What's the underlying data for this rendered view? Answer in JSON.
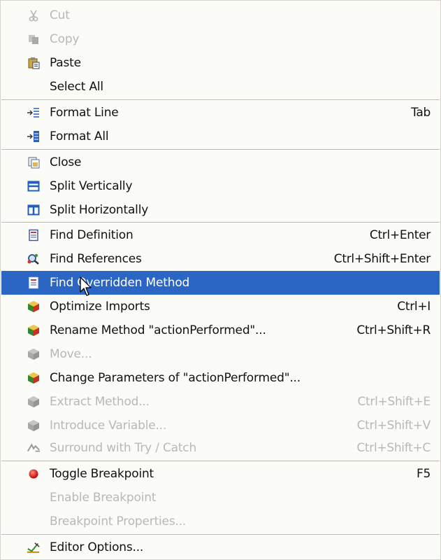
{
  "menu": {
    "items": [
      {
        "label": "Cut",
        "shortcut": "",
        "icon": "cut-icon",
        "enabled": false
      },
      {
        "label": "Copy",
        "shortcut": "",
        "icon": "copy-icon",
        "enabled": false
      },
      {
        "label": "Paste",
        "shortcut": "",
        "icon": "paste-icon",
        "enabled": true
      },
      {
        "label": "Select All",
        "shortcut": "",
        "icon": "",
        "enabled": true
      },
      {
        "label": "Format Line",
        "shortcut": "Tab",
        "icon": "format-line-icon",
        "enabled": true
      },
      {
        "label": "Format All",
        "shortcut": "",
        "icon": "format-all-icon",
        "enabled": true
      },
      {
        "label": "Close",
        "shortcut": "",
        "icon": "close-file-icon",
        "enabled": true
      },
      {
        "label": "Split Vertically",
        "shortcut": "",
        "icon": "split-vertically-icon",
        "enabled": true
      },
      {
        "label": "Split Horizontally",
        "shortcut": "",
        "icon": "split-horizontally-icon",
        "enabled": true
      },
      {
        "label": "Find Definition",
        "shortcut": "Ctrl+Enter",
        "icon": "find-definition-icon",
        "enabled": true
      },
      {
        "label": "Find References",
        "shortcut": "Ctrl+Shift+Enter",
        "icon": "find-references-icon",
        "enabled": true
      },
      {
        "label": "Find Overridden Method",
        "shortcut": "",
        "icon": "find-overridden-icon",
        "enabled": true,
        "selected": true
      },
      {
        "label": "Optimize Imports",
        "shortcut": "Ctrl+I",
        "icon": "refactor-cube-icon",
        "enabled": true
      },
      {
        "label": "Rename Method \"actionPerformed\"...",
        "shortcut": "Ctrl+Shift+R",
        "icon": "refactor-cube-icon",
        "enabled": true
      },
      {
        "label": "Move...",
        "shortcut": "",
        "icon": "refactor-cube-icon",
        "enabled": false
      },
      {
        "label": "Change Parameters of  \"actionPerformed\"...",
        "shortcut": "",
        "icon": "refactor-cube-icon",
        "enabled": true
      },
      {
        "label": "Extract Method...",
        "shortcut": "Ctrl+Shift+E",
        "icon": "refactor-cube-icon",
        "enabled": false
      },
      {
        "label": "Introduce Variable...",
        "shortcut": "Ctrl+Shift+V",
        "icon": "refactor-cube-icon",
        "enabled": false
      },
      {
        "label": "Surround with Try / Catch",
        "shortcut": "Ctrl+Shift+C",
        "icon": "surround-try-icon",
        "enabled": false
      },
      {
        "label": "Toggle Breakpoint",
        "shortcut": "F5",
        "icon": "breakpoint-icon",
        "enabled": true
      },
      {
        "label": "Enable Breakpoint",
        "shortcut": "",
        "icon": "",
        "enabled": false
      },
      {
        "label": "Breakpoint Properties...",
        "shortcut": "",
        "icon": "",
        "enabled": false
      },
      {
        "label": "Editor Options...",
        "shortcut": "",
        "icon": "editor-options-icon",
        "enabled": true
      }
    ]
  },
  "colors": {
    "selection": "#2c66c5",
    "disabled_text": "#b8b8b8",
    "menu_background": "#fbfbf8"
  }
}
